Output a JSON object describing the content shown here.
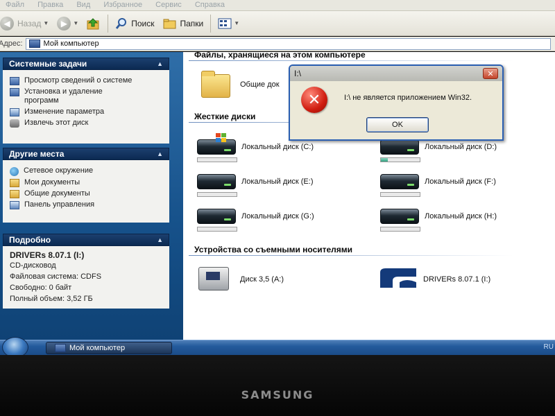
{
  "menubar": {
    "items": [
      "Файл",
      "Правка",
      "Вид",
      "Избранное",
      "Сервис",
      "Справка"
    ]
  },
  "toolbar": {
    "back_label": "Назад",
    "search_label": "Поиск",
    "folders_label": "Папки"
  },
  "address": {
    "label": "Адрес:",
    "value": "Мой компьютер"
  },
  "sidebar": {
    "system_tasks": {
      "title": "Системные задачи",
      "items": [
        {
          "label": "Просмотр сведений о системе",
          "icon": "system-info-icon"
        },
        {
          "label": "Установка и удаление программ",
          "icon": "add-remove-programs-icon"
        },
        {
          "label": "Изменение параметра",
          "icon": "control-panel-icon"
        },
        {
          "label": "Извлечь этот диск",
          "icon": "eject-icon"
        }
      ]
    },
    "other_places": {
      "title": "Другие места",
      "items": [
        {
          "label": "Сетевое окружение",
          "icon": "network-icon"
        },
        {
          "label": "Мои документы",
          "icon": "folder-icon"
        },
        {
          "label": "Общие документы",
          "icon": "folder-icon"
        },
        {
          "label": "Панель управления",
          "icon": "control-panel-icon"
        }
      ]
    },
    "details": {
      "title": "Подробно",
      "name": "DRIVERs 8.07.1 (I:)",
      "type": "CD-дисковод",
      "filesystem": "Файловая система: CDFS",
      "free": "Свободно: 0 байт",
      "total": "Полный объем: 3,52 ГБ"
    }
  },
  "main": {
    "stored_files": {
      "title": "Файлы, хранящиеся на этом компьютере",
      "items": [
        {
          "label": "Общие док",
          "icon": "folder-icon"
        }
      ]
    },
    "hard_disks": {
      "title": "Жесткие диски",
      "drives": [
        {
          "label": "Локальный диск (C:)",
          "used_fraction": 0.0,
          "system": true
        },
        {
          "label": "Локальный диск (D:)",
          "used_fraction": 0.17,
          "system": false
        },
        {
          "label": "Локальный диск (E:)",
          "used_fraction": 0.0,
          "system": false
        },
        {
          "label": "Локальный диск (F:)",
          "used_fraction": 0.0,
          "system": false
        },
        {
          "label": "Локальный диск (G:)",
          "used_fraction": 0.0,
          "system": false
        },
        {
          "label": "Локальный диск (H:)",
          "used_fraction": 0.0,
          "system": false
        }
      ]
    },
    "removable": {
      "title": "Устройства со съемными носителями",
      "items": [
        {
          "label": "Диск 3,5 (A:)",
          "icon": "floppy-drive-icon"
        },
        {
          "label": "DRIVERs 8.07.1 (I:)",
          "icon": "cd-drive-icon"
        }
      ]
    }
  },
  "dialog": {
    "title": "I:\\",
    "close_glyph": "✕",
    "icon_glyph": "✕",
    "message": "I:\\ не является приложением Win32.",
    "ok_label": "OK"
  },
  "taskbar": {
    "window_button": "Мой компьютер",
    "tray_text": "RU"
  },
  "bezel": {
    "brand": "SAMSUNG"
  },
  "colors": {
    "sidebar": "#16518a",
    "dialog_border": "#2a5fb2",
    "error_red": "#d01d10",
    "capacity_fill": "#31a07f"
  }
}
